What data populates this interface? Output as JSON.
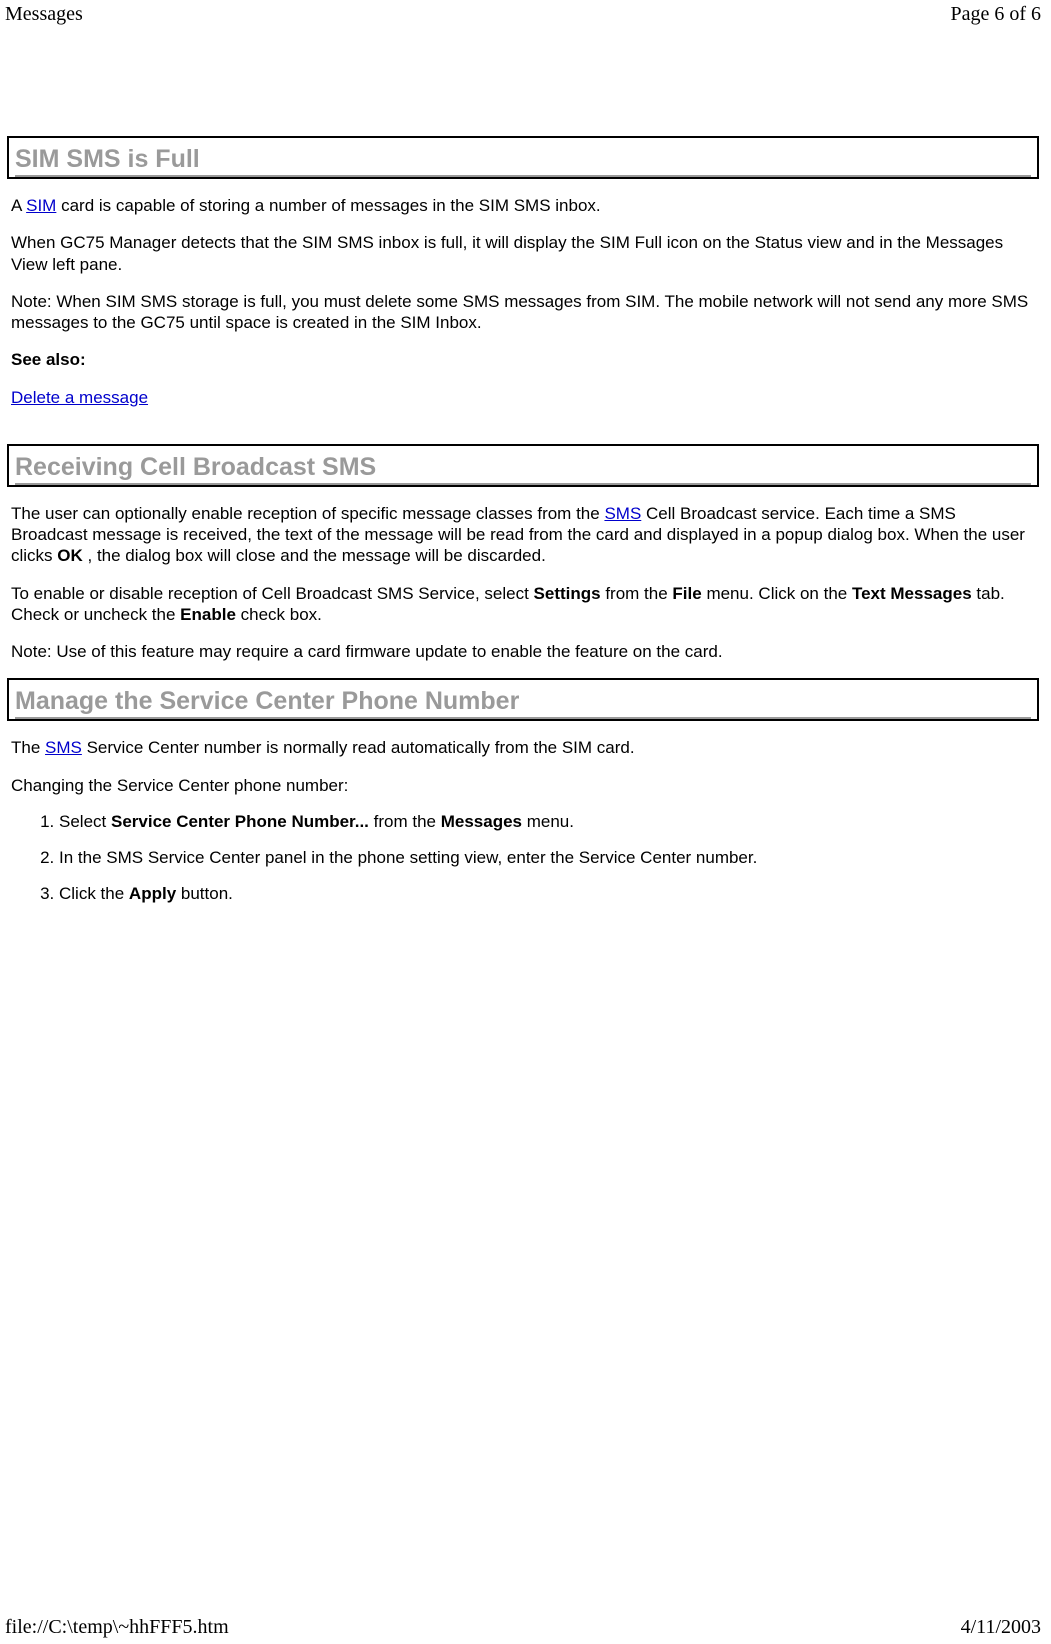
{
  "header": {
    "left": "Messages",
    "right": "Page 6 of 6"
  },
  "footer": {
    "left": "file://C:\\temp\\~hhFFF5.htm",
    "right": "4/11/2003"
  },
  "sections": {
    "sim_full": {
      "title": "SIM SMS is Full",
      "p1_a": "A ",
      "p1_link": "SIM",
      "p1_b": " card is capable of storing a number of messages in the SIM SMS inbox.",
      "p2": "When GC75 Manager detects that the SIM SMS inbox is full, it will display the SIM Full icon on the Status view and in the Messages View left pane.",
      "p3": "Note: When SIM SMS storage is full, you must delete some SMS messages from SIM. The mobile network will not send any more SMS messages to the GC75 until space is created in the SIM Inbox.",
      "see_also": "See also:",
      "link_delete": "Delete a message"
    },
    "cell_broadcast": {
      "title": "Receiving Cell Broadcast SMS",
      "p1_a": "The user can optionally enable reception of specific message classes from the ",
      "p1_link": "SMS",
      "p1_b": " Cell Broadcast service. Each time a SMS Broadcast message is received, the text of the message will be read from the card and displayed in a popup dialog box. When the user clicks ",
      "p1_bold_ok": "OK",
      "p1_c": " , the dialog box will close and the message will be discarded.",
      "p2_a": "To enable or disable reception of Cell Broadcast SMS Service, select ",
      "p2_bold_settings": "Settings",
      "p2_b": " from the ",
      "p2_bold_file": "File",
      "p2_c": " menu. Click on the ",
      "p2_bold_textmsgs": "Text Messages",
      "p2_d": " tab. Check or uncheck the ",
      "p2_bold_enable": "Enable",
      "p2_e": " check box.",
      "p3": "Note: Use of this feature may require a card firmware update to enable the feature on the card."
    },
    "service_center": {
      "title": "Manage the Service Center Phone Number",
      "p1_a": "The ",
      "p1_link": "SMS",
      "p1_b": " Service Center number is normally read automatically from the SIM card.",
      "p2": "Changing the Service Center phone number:",
      "steps": {
        "s1_a": "Select ",
        "s1_bold": "Service Center Phone Number...",
        "s1_b": " from the ",
        "s1_bold2": "Messages",
        "s1_c": " menu.",
        "s2": "In the SMS Service Center panel in the phone setting view, enter the Service Center number.",
        "s3_a": "Click the ",
        "s3_bold": "Apply",
        "s3_b": " button."
      }
    }
  }
}
